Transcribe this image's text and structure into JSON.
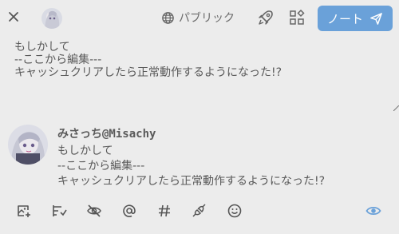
{
  "header": {
    "close_icon": "close-icon",
    "visibility_label": "パブリック",
    "visibility_icon": "globe-icon",
    "rocket_icon": "rocket-icon",
    "widgets_icon": "widgets-icon",
    "submit_label": "ノート",
    "submit_icon": "send-icon",
    "accent_color": "#6aa1d9"
  },
  "editor": {
    "text": "もしかして\n--ここから編集---\nキャッシュクリアしたら正常動作するようになった!?"
  },
  "preview": {
    "display_name": "みさっち@Misachy",
    "lines": [
      "もしかして",
      "--ここから編集---",
      "キャッシュクリアしたら正常動作するようになった!?"
    ]
  },
  "toolbar": {
    "icons": [
      "image-add-icon",
      "poll-icon",
      "eye-off-icon",
      "mention-icon",
      "hashtag-icon",
      "plugin-icon",
      "emoji-icon"
    ],
    "preview_toggle_icon": "eye-icon",
    "preview_toggle_color": "#6aa1d9"
  }
}
